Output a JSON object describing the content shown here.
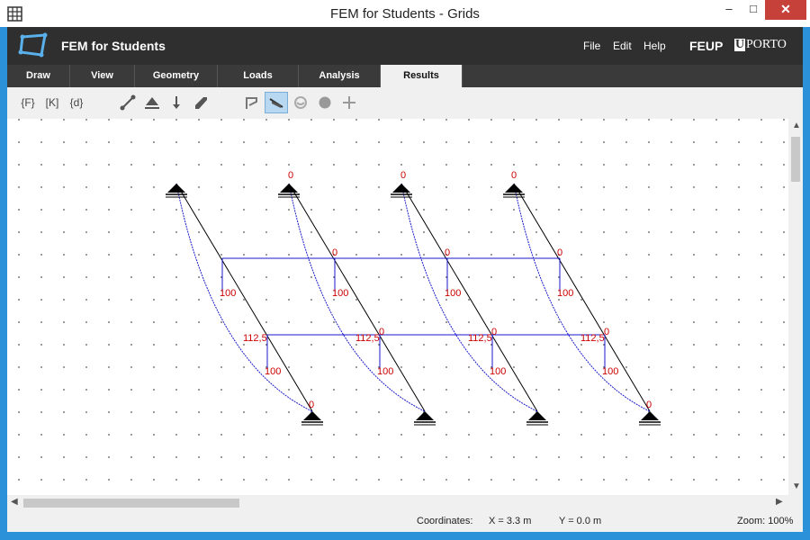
{
  "window": {
    "title": "FEM for Students - Grids",
    "minimize": "–",
    "maximize": "□",
    "close": "✕"
  },
  "app": {
    "name": "FEM for Students",
    "menu": [
      "File",
      "Edit",
      "Help"
    ],
    "brand1": "FEUP",
    "brand2_letter": "U",
    "brand2_text": "PORTO"
  },
  "tabs": [
    "Draw",
    "View",
    "Geometry",
    "Loads",
    "Analysis",
    "Results"
  ],
  "active_tab": "Results",
  "toolbar": {
    "f_label": "{F}",
    "k_label": "[K]",
    "d_label": "{d}",
    "icons": [
      "element-icon",
      "support-icon",
      "load-arrow-icon",
      "moment-icon",
      "structure-icon",
      "diagram-icon",
      "deformed-icon",
      "circle-icon",
      "add-icon"
    ]
  },
  "canvas": {
    "labels": {
      "top_zero": "0",
      "beam_zero": "0",
      "value_100": "100",
      "value_112": "112,5",
      "bottom_zero": "0"
    }
  },
  "status": {
    "coordinates_label": "Coordinates:",
    "x": "X = 3.3 m",
    "y": "Y = 0.0 m",
    "zoom": "Zoom: 100%"
  },
  "colors": {
    "accent": "#2b91d9",
    "diagram": "#1a1acc",
    "label": "#cc0000",
    "close": "#c7413b"
  }
}
